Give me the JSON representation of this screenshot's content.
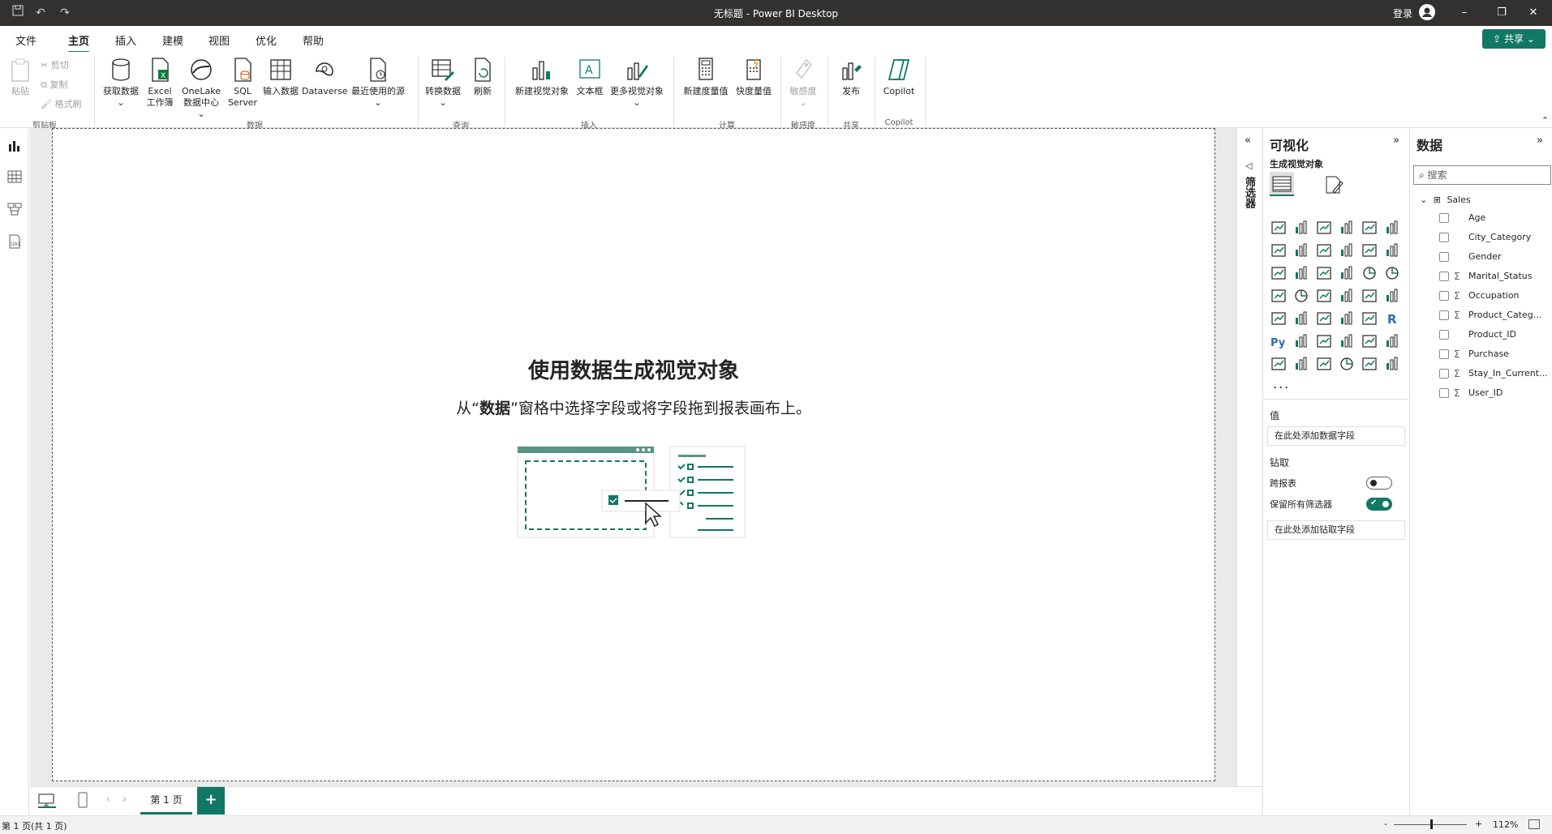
{
  "window": {
    "title": "无标题 - Power BI Desktop",
    "signin": "登录",
    "share": "共享"
  },
  "menu": [
    "文件",
    "主页",
    "插入",
    "建模",
    "视图",
    "优化",
    "帮助"
  ],
  "ribbon": {
    "clipboard": {
      "paste": "粘贴",
      "cut": "剪切",
      "copy": "复制",
      "format": "格式刷",
      "group": "剪贴板"
    },
    "data": {
      "get": "获取数据",
      "excel1": "Excel",
      "excel2": "工作簿",
      "onelake1": "OneLake",
      "onelake2": "数据中心",
      "sql1": "SQL",
      "sql2": "Server",
      "enter": "输入数据",
      "dataverse": "Dataverse",
      "recent": "最近使用的源",
      "group": "数据"
    },
    "query": {
      "transform": "转换数据",
      "refresh": "刷新",
      "group": "查询"
    },
    "insert": {
      "newvisual": "新建视觉对象",
      "textbox": "文本框",
      "more": "更多视觉对象",
      "group": "插入"
    },
    "calc": {
      "measure": "新建度量值",
      "quick": "快度量值",
      "group": "计算"
    },
    "sensitivity": {
      "label": "敏感度",
      "group": "敏感度"
    },
    "share": {
      "publish": "发布",
      "group": "共享"
    },
    "copilot": {
      "label": "Copilot",
      "group": "Copilot"
    }
  },
  "canvas": {
    "title": "使用数据生成视觉对象",
    "sub_pre": "从“",
    "sub_bold": "数据",
    "sub_post": "”窗格中选择字段或将字段拖到报表画布上。"
  },
  "filters": {
    "label": "筛选器"
  },
  "viz": {
    "title": "可视化",
    "build": "生成视觉对象",
    "values_label": "值",
    "values_placeholder": "在此处添加数据字段",
    "drill_label": "钻取",
    "cross_report": "跨报表",
    "keep_filters": "保留所有筛选器",
    "drill_placeholder": "在此处添加钻取字段",
    "more": "..."
  },
  "data": {
    "title": "数据",
    "search_placeholder": "搜索",
    "table": "Sales",
    "fields": [
      {
        "name": "Age",
        "sigma": ""
      },
      {
        "name": "City_Category",
        "sigma": ""
      },
      {
        "name": "Gender",
        "sigma": ""
      },
      {
        "name": "Marital_Status",
        "sigma": "Σ"
      },
      {
        "name": "Occupation",
        "sigma": "Σ"
      },
      {
        "name": "Product_Categ...",
        "sigma": "Σ"
      },
      {
        "name": "Product_ID",
        "sigma": ""
      },
      {
        "name": "Purchase",
        "sigma": "Σ"
      },
      {
        "name": "Stay_In_Current...",
        "sigma": "Σ"
      },
      {
        "name": "User_ID",
        "sigma": "Σ"
      }
    ]
  },
  "pages": {
    "tab": "第 1 页",
    "add": "+"
  },
  "status": {
    "page": "第 1 页(共 1 页)",
    "zoom": "112%",
    "minus": "-",
    "plus": "+"
  },
  "colors": {
    "accent": "#117865",
    "titlebar": "#323130"
  }
}
